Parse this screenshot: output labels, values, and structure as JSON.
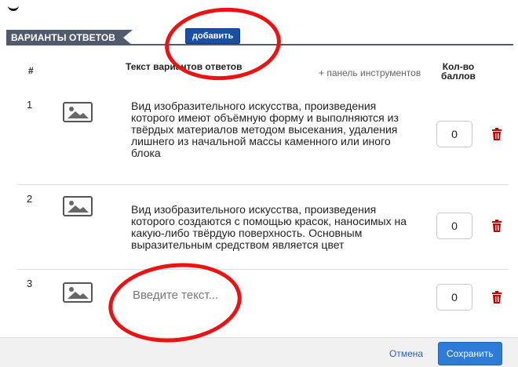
{
  "section": {
    "title": "ВАРИАНТЫ ОТВЕТОВ",
    "add_label": "добавить"
  },
  "columns": {
    "number": "#",
    "text": "Текст вариантов ответов",
    "toolbar": "+ панель инструментов",
    "score": "Кол-во баллов"
  },
  "rows": [
    {
      "number": "1",
      "text": "Вид изобразительного искусства, произведения которого имеют объёмную форму и выполняются из твёрдых материалов методом высекания, удаления лишнего из начальной массы каменного или иного блока",
      "score": "0",
      "icon": "image-icon"
    },
    {
      "number": "2",
      "text": "Вид изобразительного искусства, произведения которого создаются с помощью красок, наносимых на какую-либо твёрдую поверхность. Основным выразительным средством является цвет",
      "score": "0",
      "icon": "image-icon"
    },
    {
      "number": "3",
      "placeholder": "Введите текст...",
      "score": "0",
      "icon": "image-icon"
    }
  ],
  "footer": {
    "cancel_label": "Отмена",
    "save_label": "Сохранить"
  },
  "colors": {
    "accent": "#1a4fa8",
    "save": "#2d7bd6",
    "delete": "#c00000",
    "annotation": "#e11111"
  }
}
